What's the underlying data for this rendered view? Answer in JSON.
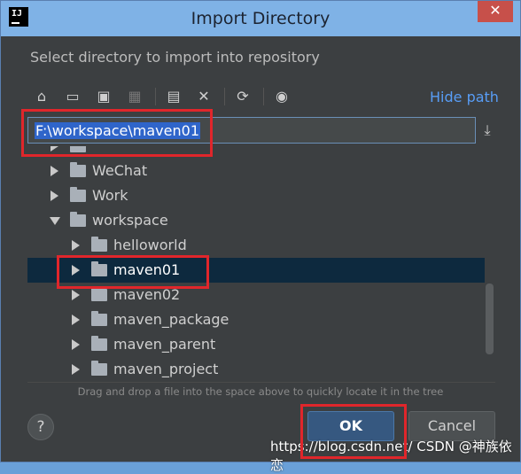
{
  "window": {
    "title": "Import Directory",
    "app_icon_label": "IJ",
    "close_label": "✕"
  },
  "dialog": {
    "subtitle": "Select directory to import into repository",
    "hide_path_label": "Hide path",
    "path_value": "F:\\workspace\\maven01",
    "hint": "Drag and drop a file into the space above to quickly locate it in the tree",
    "help_label": "?",
    "ok_label": "OK",
    "cancel_label": "Cancel"
  },
  "toolbar": {
    "icons": [
      "home-icon",
      "desktop-icon",
      "project-icon",
      "module-icon",
      "new-folder-icon",
      "delete-icon",
      "refresh-icon",
      "show-hidden-icon"
    ],
    "glyphs": {
      "home": "⌂",
      "desktop": "▭",
      "project": "▣",
      "module": "▦",
      "new_folder": "▤",
      "delete": "✕",
      "refresh": "⟳",
      "show_hidden": "◉"
    },
    "download_glyph": "⤓"
  },
  "tree": {
    "items": [
      {
        "label": "WeChat",
        "expanded": false,
        "selected": false
      },
      {
        "label": "Work",
        "expanded": false,
        "selected": false
      },
      {
        "label": "workspace",
        "expanded": true,
        "selected": false
      },
      {
        "label": "helloworld",
        "expanded": false,
        "selected": false
      },
      {
        "label": "maven01",
        "expanded": false,
        "selected": true
      },
      {
        "label": "maven02",
        "expanded": false,
        "selected": false
      },
      {
        "label": "maven_package",
        "expanded": false,
        "selected": false
      },
      {
        "label": "maven_parent",
        "expanded": false,
        "selected": false
      },
      {
        "label": "maven_project",
        "expanded": false,
        "selected": false
      }
    ]
  },
  "watermark": "https://blog.csdn.net/ CSDN @神族依恋",
  "colors": {
    "background": "#3c3f41",
    "title_bar": "#7fb2e6",
    "selection": "#0d293e",
    "link": "#589df6",
    "ok_button": "#365880",
    "annotation": "#e0262b"
  }
}
